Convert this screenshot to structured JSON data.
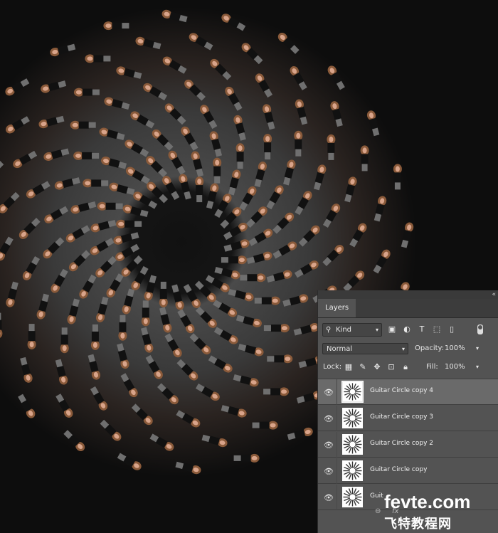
{
  "panel": {
    "tab_label": "Layers",
    "filter": {
      "kind_label": "Kind",
      "icons": [
        "image-filter-icon",
        "adjustment-filter-icon",
        "type-filter-icon",
        "shape-filter-icon",
        "smart-object-filter-icon"
      ]
    },
    "blend_mode": "Normal",
    "opacity_label": "Opacity:",
    "opacity_value": "100%",
    "lock_label": "Lock:",
    "fill_label": "Fill:",
    "fill_value": "100%",
    "layers": [
      {
        "name": "Guitar Circle copy 4",
        "selected": true
      },
      {
        "name": "Guitar Circle copy 3",
        "selected": false
      },
      {
        "name": "Guitar Circle copy 2",
        "selected": false
      },
      {
        "name": "Guitar Circle copy",
        "selected": false
      },
      {
        "name": "Guit",
        "selected": false
      }
    ]
  },
  "watermark": {
    "line1": "fevte.com",
    "line2": "飞特教程网"
  },
  "colors": {
    "panel_bg": "#535353",
    "selected_row": "#6a6a6a",
    "canvas_bg": "#0b0b0b"
  }
}
